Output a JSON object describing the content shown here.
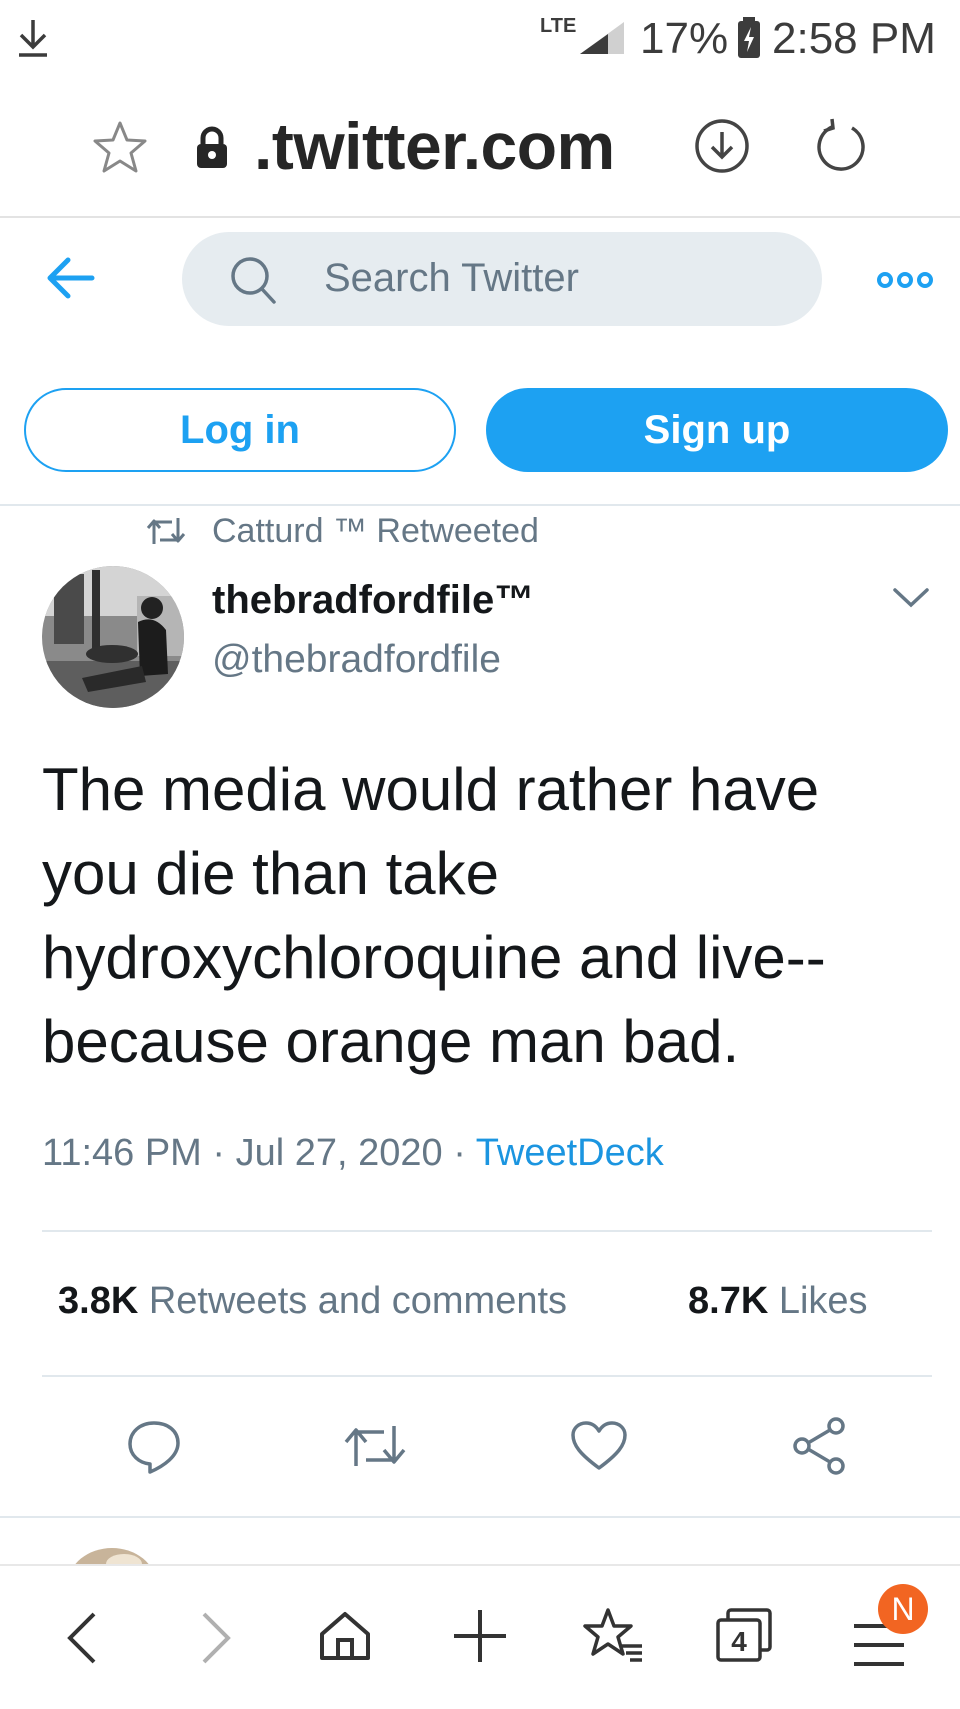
{
  "status_bar": {
    "network": "LTE",
    "battery": "17%",
    "time": "2:58 PM"
  },
  "browser": {
    "url": ".twitter.com",
    "tab_count": "4",
    "menu_badge": "N"
  },
  "header": {
    "search_placeholder": "Search Twitter",
    "login_label": "Log in",
    "signup_label": "Sign up"
  },
  "tweet": {
    "retweeted_by": "Catturd ™ Retweeted",
    "display_name": "thebradfordfile™",
    "handle": "@thebradfordfile",
    "text": "The media would rather have\nyou die than take\nhydroxychloroquine and live--\nbecause orange man bad.",
    "time": "11:46 PM",
    "date": "Jul 27, 2020",
    "source": "TweetDeck",
    "retweets_count": "3.8K",
    "retweets_label": "Retweets and comments",
    "likes_count": "8.7K",
    "likes_label": "Likes"
  },
  "colors": {
    "twitter_blue": "#1da1f2",
    "link_blue": "#1b95e0",
    "text_gray": "#657786",
    "badge_orange": "#f26522"
  },
  "icons": {
    "download": "download-icon",
    "signal": "signal-icon",
    "battery": "battery-icon",
    "bookmark_star": "star-icon",
    "lock": "lock-icon",
    "page_download": "download-circle-icon",
    "reload": "reload-icon",
    "back": "back-arrow-icon",
    "search": "search-icon",
    "more": "more-icon",
    "retweet": "retweet-icon",
    "chevron": "chevron-down-icon",
    "reply": "reply-icon",
    "like": "heart-icon",
    "share": "share-icon",
    "nav_back": "nav-back-icon",
    "nav_forward": "nav-forward-icon",
    "home": "home-icon",
    "new_tab": "plus-icon",
    "bookmarks": "bookmarks-icon",
    "tabs": "tabs-icon",
    "menu": "menu-icon"
  }
}
